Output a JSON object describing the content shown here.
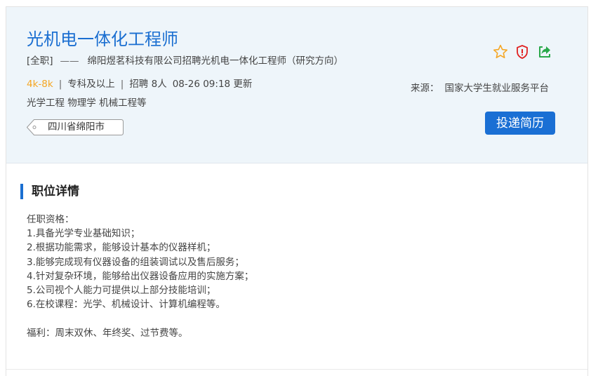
{
  "job": {
    "title": "光机电一体化工程师",
    "type_tag": "[全职]",
    "dash": "——",
    "company_line": "绵阳煜茗科技有限公司招聘光机电一体化工程师（研究方向）",
    "salary": "4k-8k",
    "separator": "|",
    "education": "专科及以上",
    "recruit_count": "招聘 8人",
    "updated": "08-26 09:18 更新",
    "majors": "光学工程 物理学 机械工程等",
    "location": "四川省绵阳市"
  },
  "actions": {
    "favorite_icon": "star-icon",
    "report_icon": "shield-alert-icon",
    "share_icon": "share-icon"
  },
  "source": {
    "label": "来源：",
    "value": "国家大学生就业服务平台"
  },
  "apply_button": {
    "label": "投递简历"
  },
  "details": {
    "section_title": "职位详情",
    "lines": [
      "任职资格：",
      "1.具备光学专业基础知识；",
      "2.根据功能需求，能够设计基本的仪器样机；",
      "3.能够完成现有仪器设备的组装调试以及售后服务；",
      "4.针对复杂环境，能够给出仪器设备应用的实施方案；",
      "5.公司视个人能力可提供以上部分技能培训；",
      "6.在校课程：光学、机械设计、计算机编程等。",
      "",
      "福利：周末双休、年终奖、过节费等。"
    ]
  },
  "colors": {
    "accent": "#1b6fd1",
    "salary": "#f5a623",
    "star": "#f5a623",
    "report": "#e02020",
    "share": "#2aa84a",
    "header_bg": "#eef5fa"
  }
}
